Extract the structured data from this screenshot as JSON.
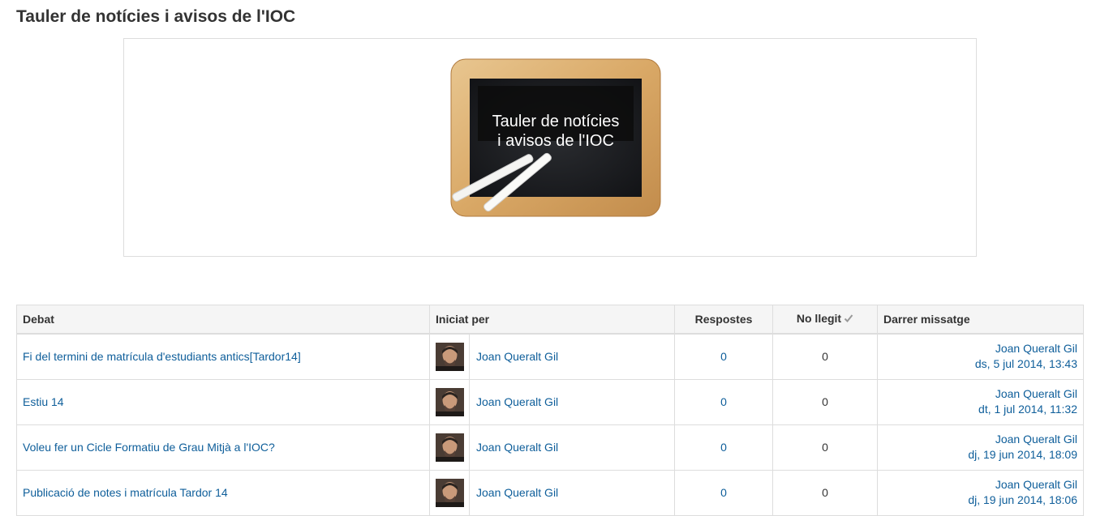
{
  "page": {
    "title": "Tauler de notícies i avisos de l'IOC"
  },
  "intro": {
    "board_line1": "Tauler de notícies",
    "board_line2": "i avisos de l'IOC"
  },
  "table": {
    "headers": {
      "discussion": "Debat",
      "started_by": "Iniciat per",
      "replies": "Respostes",
      "unread": "No llegit",
      "last_post": "Darrer missatge"
    },
    "rows": [
      {
        "topic": "Fi del termini de matrícula d'estudiants antics[Tardor14]",
        "author": "Joan Queralt Gil",
        "replies": "0",
        "unread": "0",
        "last_author": "Joan Queralt Gil",
        "last_date": "ds, 5 jul 2014, 13:43"
      },
      {
        "topic": "Estiu 14",
        "author": "Joan Queralt Gil",
        "replies": "0",
        "unread": "0",
        "last_author": "Joan Queralt Gil",
        "last_date": "dt, 1 jul 2014, 11:32"
      },
      {
        "topic": "Voleu fer un Cicle Formatiu de Grau Mitjà a l'IOC?",
        "author": "Joan Queralt Gil",
        "replies": "0",
        "unread": "0",
        "last_author": "Joan Queralt Gil",
        "last_date": "dj, 19 jun 2014, 18:09"
      },
      {
        "topic": "Publicació de notes i matrícula Tardor 14",
        "author": "Joan Queralt Gil",
        "replies": "0",
        "unread": "0",
        "last_author": "Joan Queralt Gil",
        "last_date": "dj, 19 jun 2014, 18:06"
      }
    ]
  },
  "colors": {
    "link": "#0e5e9a",
    "header_bg": "#f5f5f5",
    "border": "#dddddd"
  },
  "icons": {
    "unread_header": "check-icon",
    "avatar": "user-avatar-photo"
  }
}
